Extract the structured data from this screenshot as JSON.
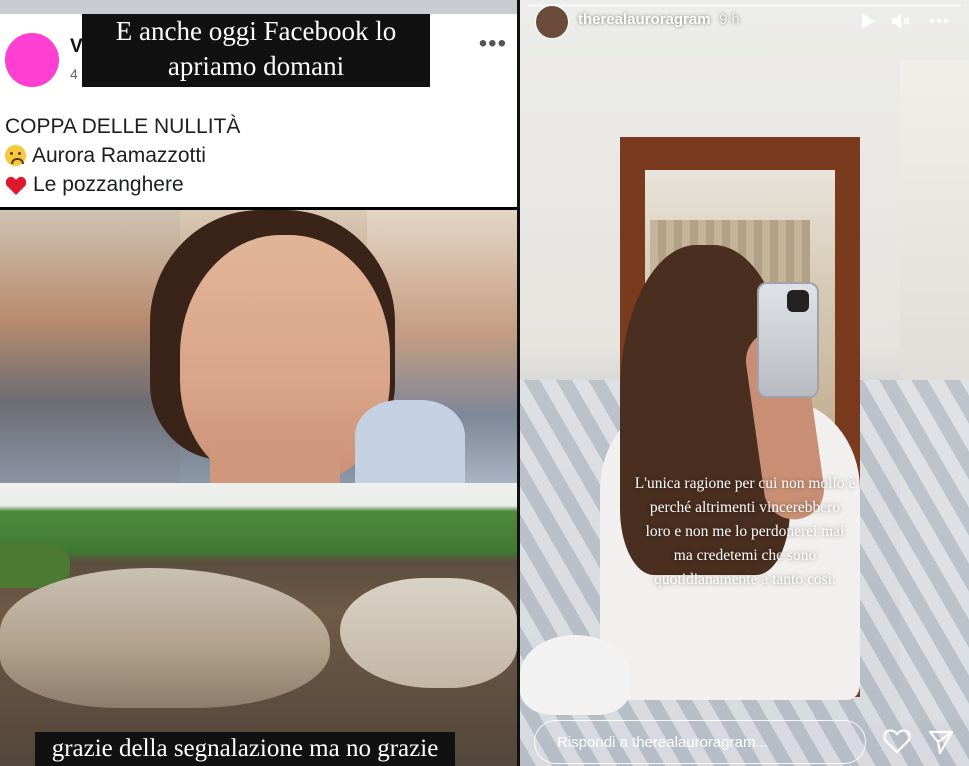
{
  "left_post": {
    "overlay_caption_line1": "E anche oggi Facebook lo",
    "overlay_caption_line2": "apriamo domani",
    "author_initial": "V",
    "time_initial": "4",
    "more_label": "•••",
    "title": "COPPA DELLE NULLITÀ",
    "items": [
      {
        "icon": "sad-face-icon",
        "label": "Aurora Ramazzotti"
      },
      {
        "icon": "red-heart-icon",
        "label": "Le pozzanghere"
      }
    ],
    "bottom_caption": "grazie della segnalazione ma no grazie"
  },
  "story": {
    "username": "therealauroragram",
    "time": "9 h",
    "text_lines": [
      "L'unica ragione per cui non mollo è",
      "perché altrimenti vincerebbero",
      "loro e non me lo perdonerei mai",
      "ma credetemi che sono",
      "quotidianamente a tanto così."
    ],
    "reply_placeholder": "Rispondi a therealauroragram...",
    "colors": {
      "accent": "#ff3fd2",
      "heart": "#e0182d"
    }
  }
}
